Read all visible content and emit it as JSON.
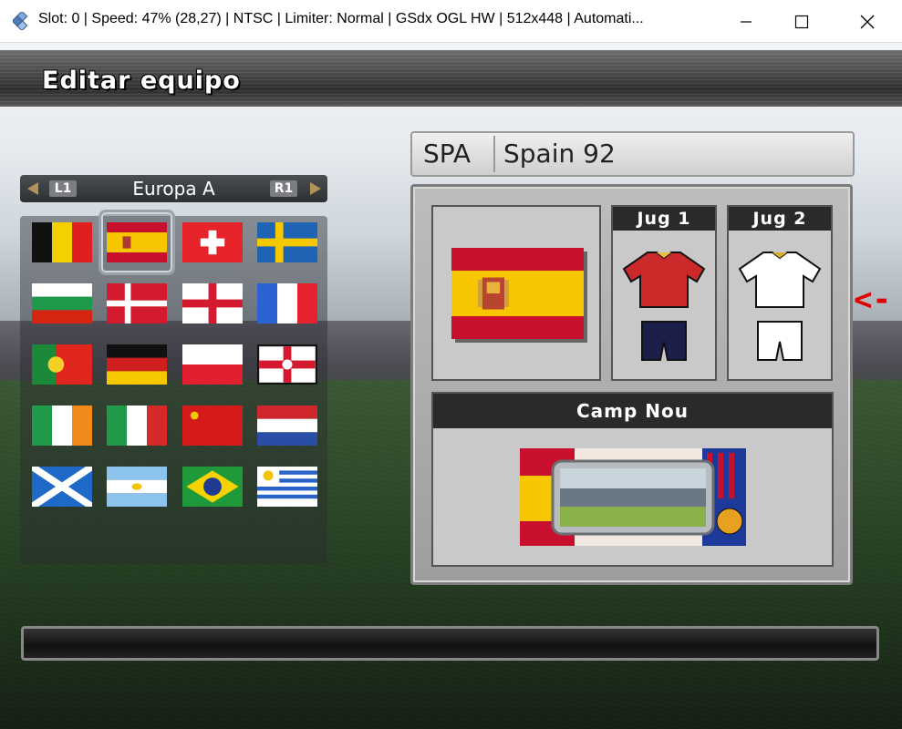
{
  "window": {
    "title": "Slot: 0 | Speed:  47% (28,27) | NTSC | Limiter: Normal | GSdx OGL HW | 512x448 | Automati..."
  },
  "screen": {
    "title": "Editar equipo"
  },
  "region": {
    "label": "Europa A",
    "left_shoulder": "L1",
    "right_shoulder": "R1"
  },
  "flags": [
    "belgium-flag",
    "spain-flag",
    "switzerland-flag",
    "sweden-flag",
    "bulgaria-flag",
    "denmark-flag",
    "england-flag",
    "france-flag",
    "portugal-flag",
    "germany-flag",
    "poland-flag",
    "northern-ireland-flag",
    "ireland-flag",
    "italy-flag",
    "ussr-flag",
    "netherlands-flag",
    "scotland-flag",
    "argentina-flag",
    "brazil-flag",
    "uruguay-flag"
  ],
  "selected_flag": "spain-flag",
  "team": {
    "code": "SPA",
    "name": "Spain 92",
    "kit1_label": "Jug 1",
    "kit2_label": "Jug 2",
    "stadium": "Camp Nou",
    "kit1_shirt_color": "#cc2a2a",
    "kit1_shorts_color": "#1b1f4a",
    "kit2_shirt_color": "#ffffff",
    "kit2_shorts_color": "#ffffff"
  },
  "overlay_arrow": "<-"
}
